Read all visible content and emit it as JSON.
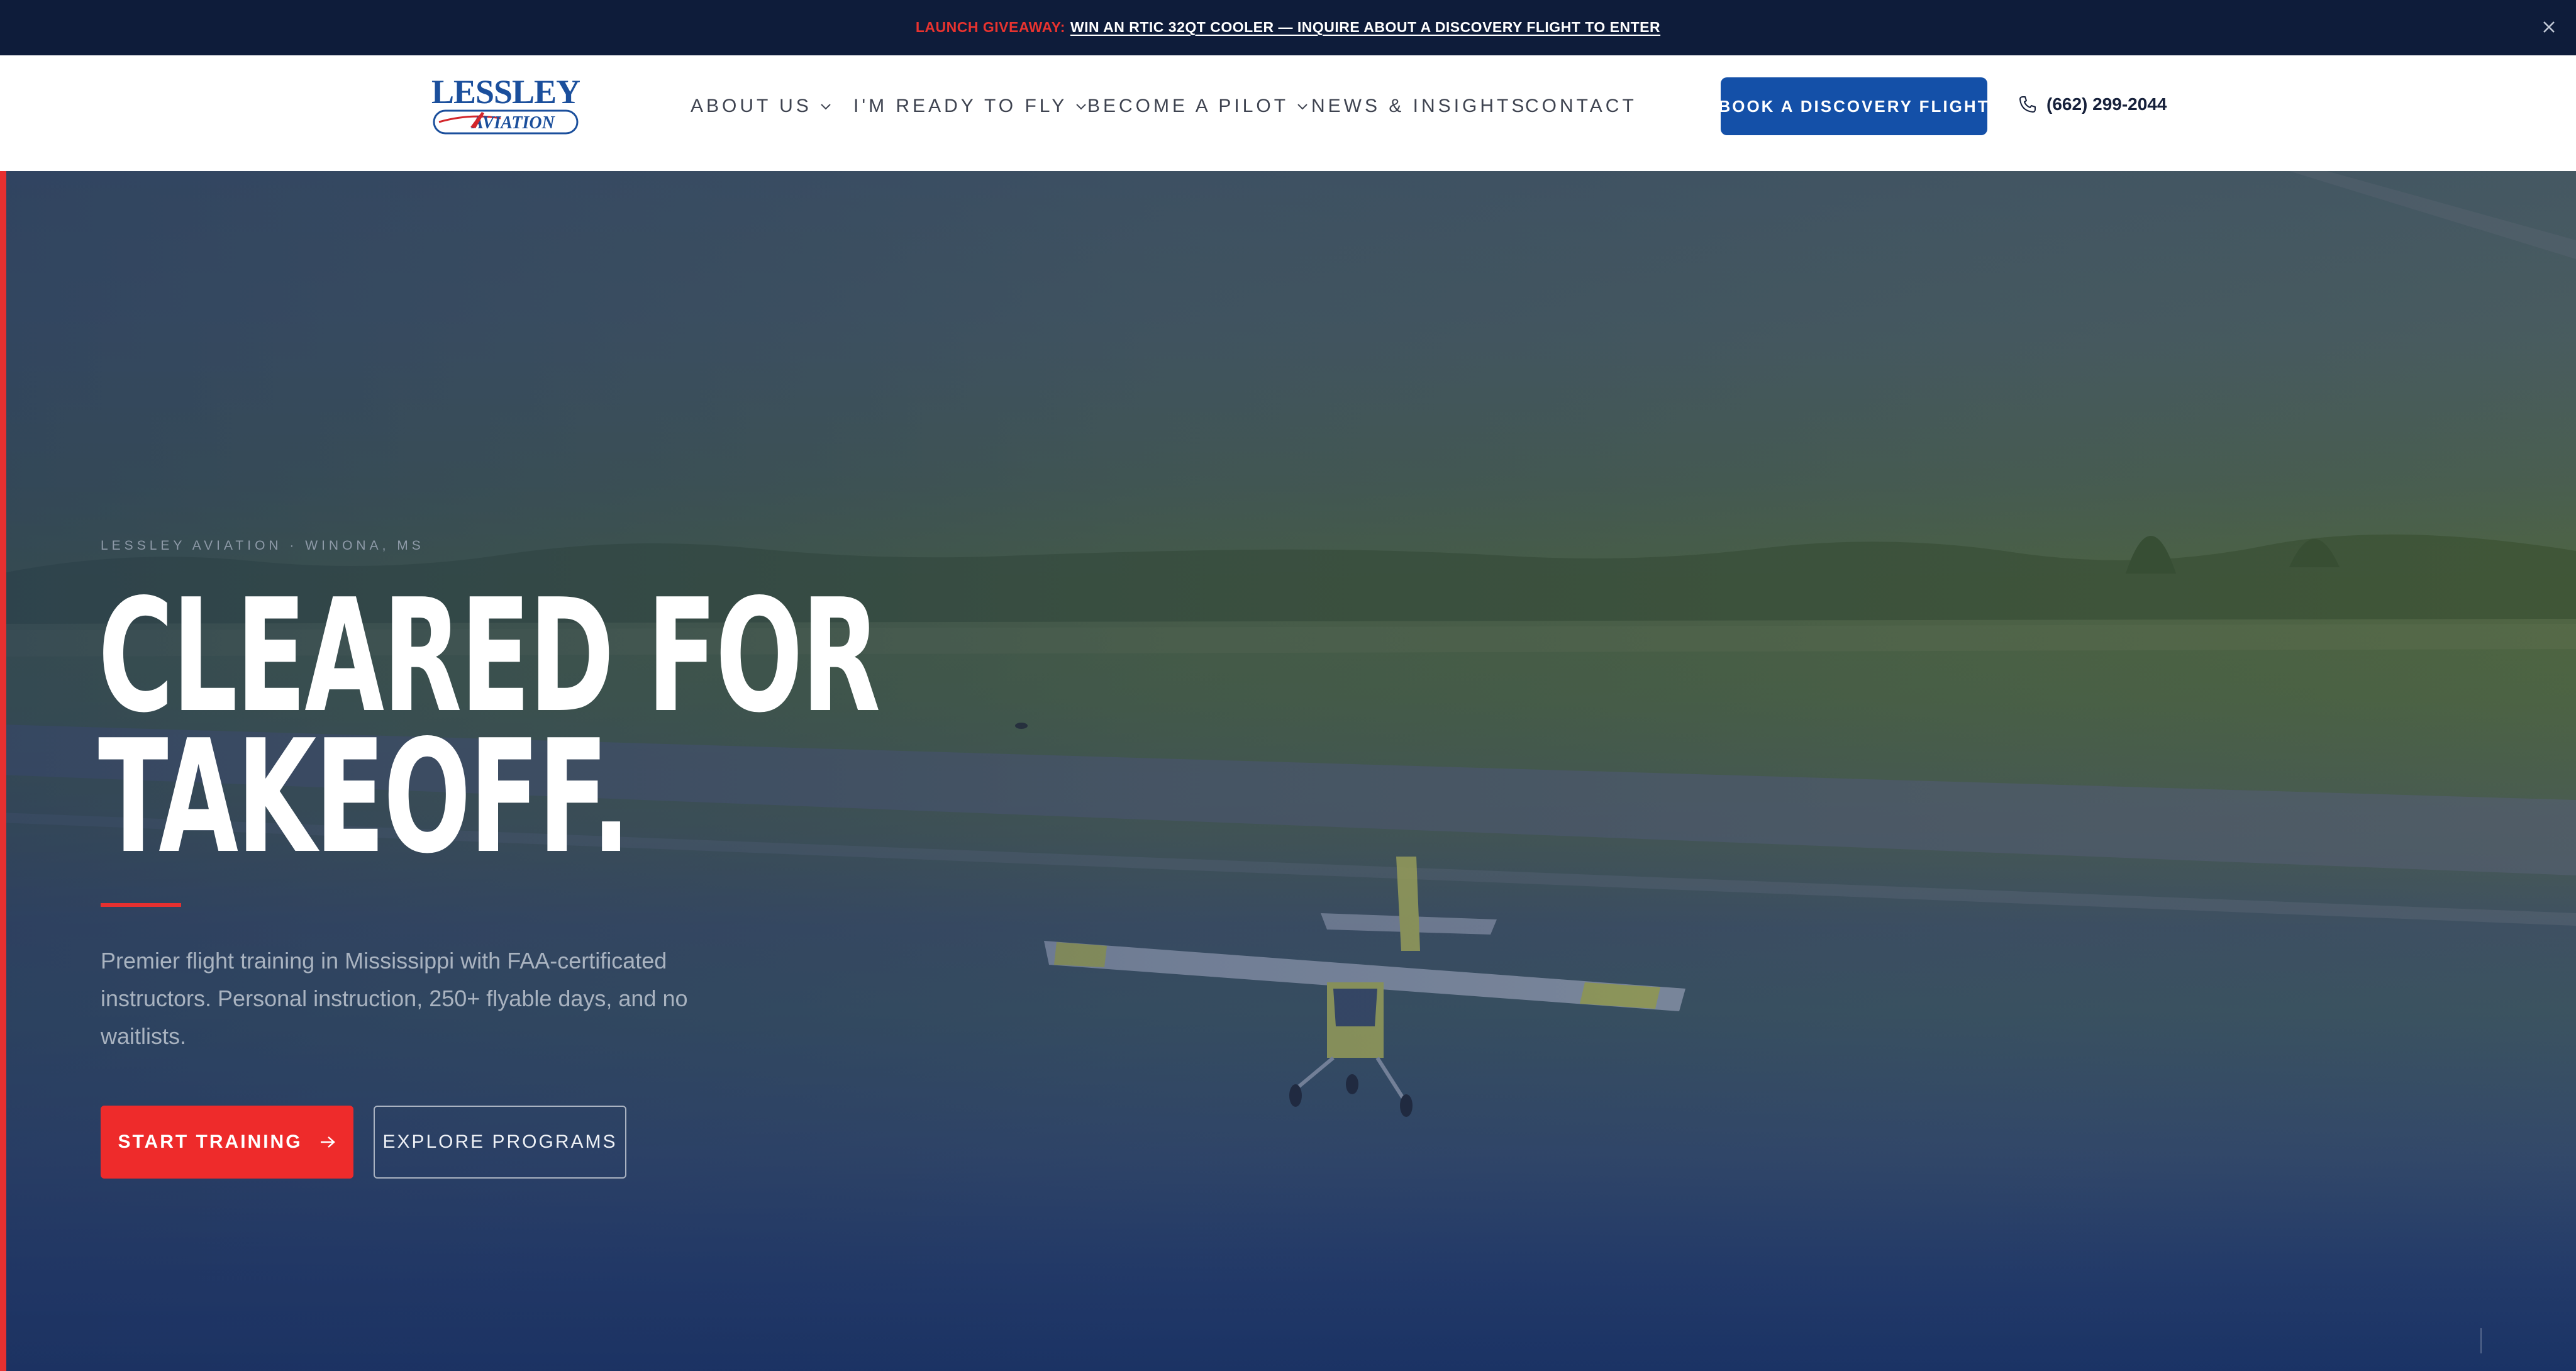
{
  "announcement": {
    "label": "LAUNCH GIVEAWAY:",
    "link_text": "WIN AN RTIC 32QT COOLER — INQUIRE ABOUT A DISCOVERY FLIGHT TO ENTER",
    "close_icon": "close-icon"
  },
  "header": {
    "logo": {
      "line1": "LESSLEY",
      "line2": "AVIATION"
    },
    "nav": [
      {
        "label": "ABOUT US",
        "has_dropdown": true
      },
      {
        "label": "I'M READY TO FLY",
        "has_dropdown": true
      },
      {
        "label": "BECOME A PILOT",
        "has_dropdown": true
      },
      {
        "label": "NEWS & INSIGHTS",
        "has_dropdown": false
      },
      {
        "label": "CONTACT",
        "has_dropdown": false
      }
    ],
    "cta_label": "BOOK A DISCOVERY FLIGHT",
    "phone": "(662) 299-2044",
    "phone_icon": "phone-icon"
  },
  "hero": {
    "eyebrow": "LESSLEY AVIATION · WINONA, MS",
    "headline_line1": "CLEARED FOR",
    "headline_line2": "TAKEOFF.",
    "subtext": "Premier flight training in Mississippi with FAA-certificated instructors. Personal instruction, 250+ flyable days, and no waitlists.",
    "primary_button": "START TRAINING",
    "primary_icon": "arrow-right-icon",
    "secondary_button": "EXPLORE PROGRAMS"
  },
  "colors": {
    "accent_red": "#e63030",
    "brand_blue": "#1450a8",
    "navy": "#0e1c3a"
  }
}
